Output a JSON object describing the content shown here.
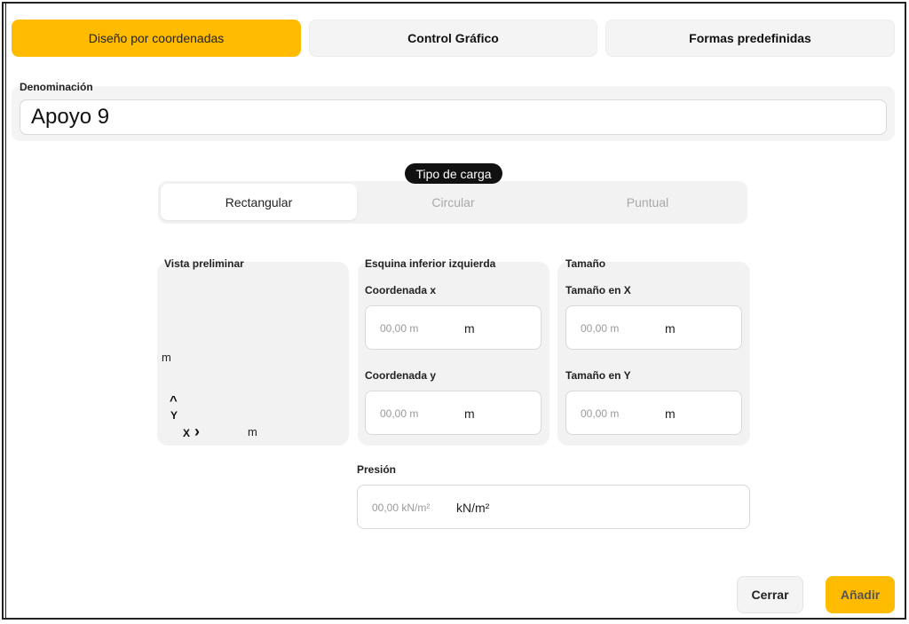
{
  "tabs": [
    {
      "label": "Diseño por coordenadas",
      "active": true
    },
    {
      "label": "Control Gráfico",
      "active": false
    },
    {
      "label": "Formas predefinidas",
      "active": false
    }
  ],
  "denominacion": {
    "label": "Denominación",
    "value": "Apoyo 9"
  },
  "tipo_carga": {
    "badge": "Tipo de carga",
    "options": [
      {
        "label": "Rectangular",
        "selected": true
      },
      {
        "label": "Circular",
        "selected": false
      },
      {
        "label": "Puntual",
        "selected": false
      }
    ]
  },
  "vista_preliminar": {
    "title": "Vista preliminar",
    "y_unit": "m",
    "x_unit": "m",
    "y_axis_label": "Y",
    "x_axis_label": "X",
    "up_arrow": "^",
    "right_arrow": "›"
  },
  "esquina": {
    "title": "Esquina inferior izquierda",
    "coord_x": {
      "label": "Coordenada x",
      "placeholder": "00,00 m",
      "unit": "m"
    },
    "coord_y": {
      "label": "Coordenada y",
      "placeholder": "00,00 m",
      "unit": "m"
    }
  },
  "tamano": {
    "title": "Tamaño",
    "size_x": {
      "label": "Tamaño en X",
      "placeholder": "00,00 m",
      "unit": "m"
    },
    "size_y": {
      "label": "Tamaño en Y",
      "placeholder": "00,00 m",
      "unit": "m"
    }
  },
  "presion": {
    "label": "Presión",
    "placeholder": "00,00 kN/m²",
    "unit": "kN/m²"
  },
  "buttons": {
    "close": "Cerrar",
    "add": "Añadir"
  },
  "colors": {
    "accent": "#ffbb00",
    "badge_bg": "#111111"
  }
}
